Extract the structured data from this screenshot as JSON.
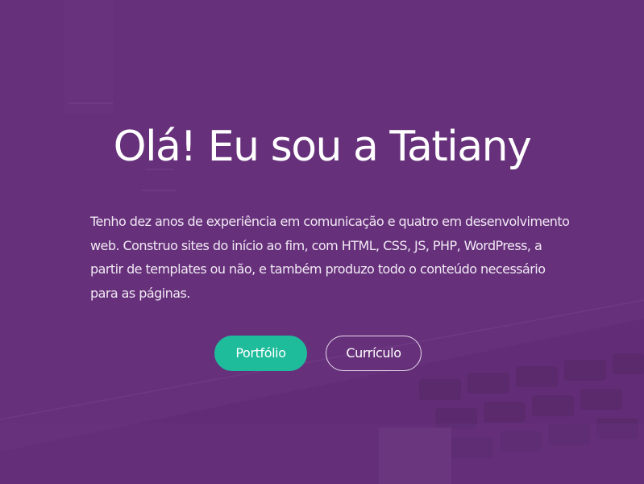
{
  "hero": {
    "title": "Olá! Eu sou a Tatiany",
    "intro": "Tenho dez anos de experiência em comunicação e quatro em desenvolvimento web. Construo sites do início ao fim, com HTML, CSS, JS, PHP, WordPress, a partir de templates ou não, e também produzo todo o conteúdo necessário para as páginas."
  },
  "buttons": {
    "portfolio_label": "Portfólio",
    "resume_label": "Currículo"
  },
  "colors": {
    "background": "#66307a",
    "accent": "#1fbc9c",
    "text": "#ffffff"
  }
}
